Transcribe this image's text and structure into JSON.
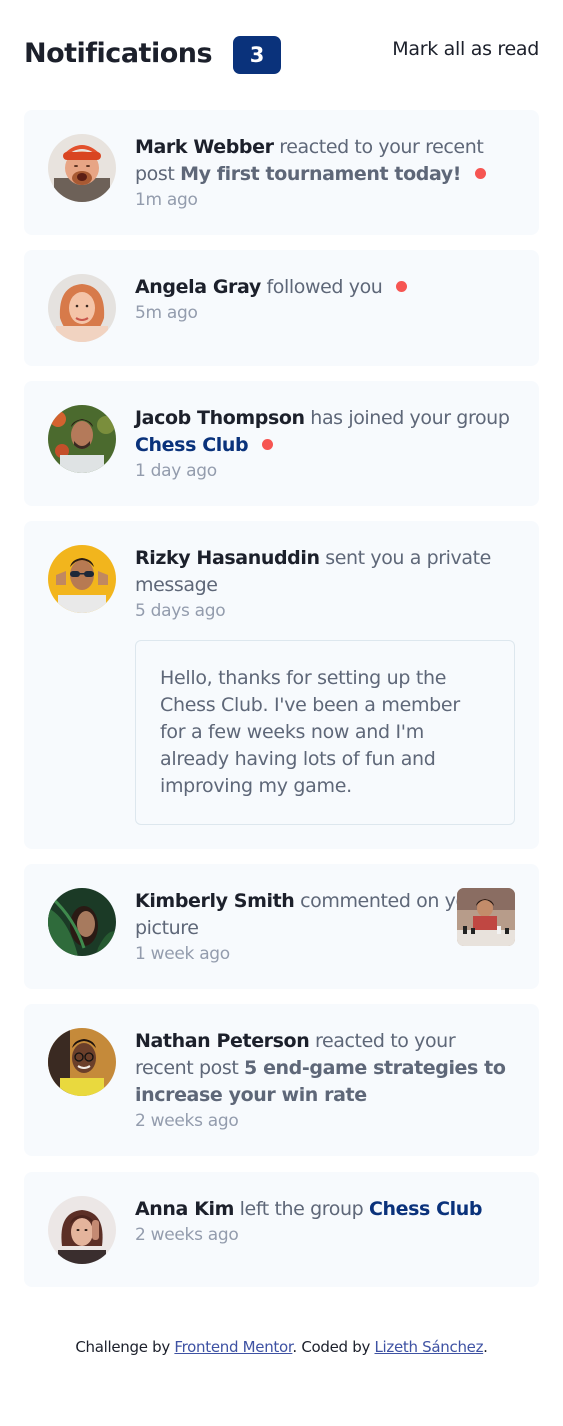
{
  "header": {
    "title": "Notifications",
    "unread_count": "3",
    "mark_all_label": "Mark all as read"
  },
  "notifications": [
    {
      "name": "Mark Webber",
      "action": "reacted to your recent post",
      "target": "My first tournament today!",
      "time": "1m ago",
      "unread": true
    },
    {
      "name": "Angela Gray",
      "action": "followed you",
      "time": "5m ago",
      "unread": true
    },
    {
      "name": "Jacob Thompson",
      "action": "has joined your group",
      "target": "Chess Club",
      "time": "1 day ago",
      "unread": true
    },
    {
      "name": "Rizky Hasanuddin",
      "action": "sent you a private message",
      "time": "5 days ago",
      "message": "Hello, thanks for setting up the Chess Club. I've been a member for a few weeks now and I'm already having lots of fun and improving my game.",
      "unread": false
    },
    {
      "name": "Kimberly Smith",
      "action": "commented on your picture",
      "time": "1 week ago",
      "unread": false
    },
    {
      "name": "Nathan Peterson",
      "action": "reacted to your recent post",
      "target": "5 end-game strategies to increase your win rate",
      "time": "2 weeks ago",
      "unread": false
    },
    {
      "name": "Anna Kim",
      "action": "left the group",
      "target": "Chess Club",
      "time": "2 weeks ago",
      "unread": false
    }
  ],
  "footer": {
    "prefix": "Challenge by",
    "link1": "Frontend Mentor",
    "middle": ". Coded by",
    "link2": "Lizeth Sánchez",
    "suffix": "."
  },
  "colors": {
    "badge": "#0a327b",
    "dot": "#f65552",
    "card_bg": "#f7fafd",
    "dark_text": "#1c202b",
    "grey_text": "#5e6778",
    "time_text": "#939cad"
  }
}
